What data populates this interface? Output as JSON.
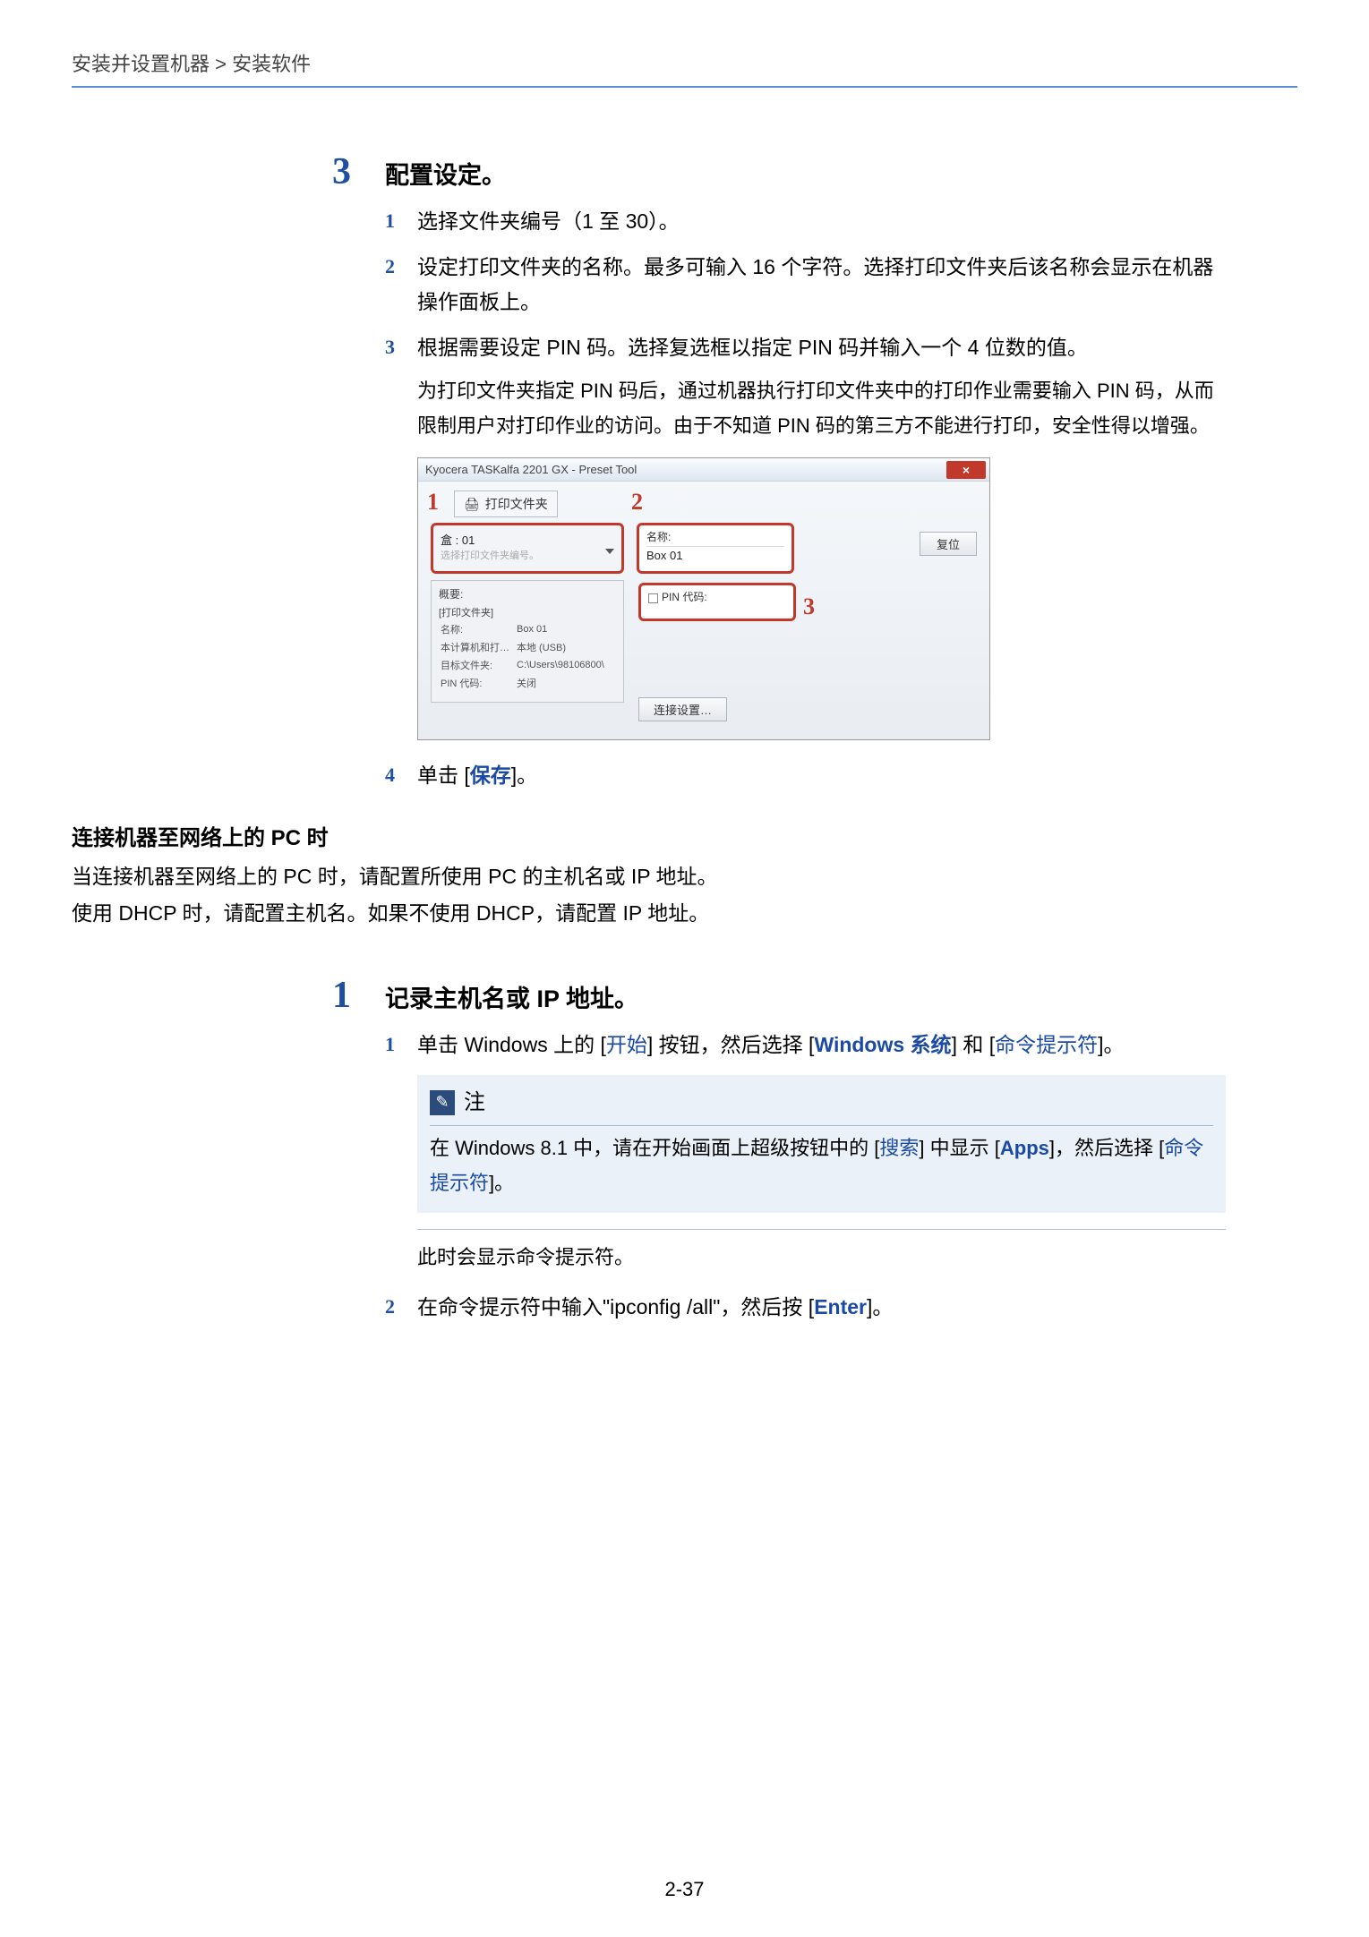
{
  "breadcrumb": "安装并设置机器 > 安装软件",
  "step3": {
    "num": "3",
    "title": "配置设定。",
    "s1": {
      "n": "1",
      "t": "选择文件夹编号（1 至 30）。"
    },
    "s2": {
      "n": "2",
      "t": "设定打印文件夹的名称。最多可输入 16 个字符。选择打印文件夹后该名称会显示在机器操作面板上。"
    },
    "s3": {
      "n": "3",
      "t": "根据需要设定 PIN 码。选择复选框以指定 PIN 码并输入一个 4 位数的值。"
    },
    "extra": "为打印文件夹指定 PIN 码后，通过机器执行打印文件夹中的打印作业需要输入 PIN 码，从而限制用户对打印作业的访问。由于不知道 PIN 码的第三方不能进行打印，安全性得以增强。",
    "s4": {
      "n": "4",
      "pre": "单击 [",
      "link": "保存",
      "post": "]。"
    }
  },
  "tool": {
    "title": "Kyocera TASKalfa 2201 GX - Preset Tool",
    "close": "×",
    "c1": "1",
    "c2": "2",
    "c3": "3",
    "printFolder": "打印文件夹",
    "boxLabel": "盒 : 01",
    "boxHint": "选择打印文件夹编号。",
    "nameLbl": "名称:",
    "nameVal": "Box 01",
    "resetBtn": "复位",
    "pinLbl": "PIN 代码:",
    "summaryHdr": "概要:",
    "sumTitle": "[打印文件夹]",
    "r1a": "名称:",
    "r1b": "Box 01",
    "r2a": "本计算机和打…",
    "r2b": "本地 (USB)",
    "r3a": "目标文件夹:",
    "r3b": "C:\\Users\\98106800\\",
    "r4a": "PIN 代码:",
    "r4b": "关闭",
    "connBtn": "连接设置…"
  },
  "netHeading": "连接机器至网络上的 PC 时",
  "netP1": "当连接机器至网络上的 PC 时，请配置所使用 PC 的主机名或 IP 地址。",
  "netP2": "使用 DHCP 时，请配置主机名。如果不使用 DHCP，请配置 IP 地址。",
  "step1": {
    "num": "1",
    "title": "记录主机名或 IP 地址。",
    "s1": {
      "n": "1",
      "a": "单击 Windows 上的 [",
      "l1": "开始",
      "b": "] 按钮，然后选择 [",
      "l2": "Windows 系统",
      "c": "] 和 [",
      "l3": "命令提示符",
      "d": "]。"
    },
    "noteLabel": "注",
    "noteBody": {
      "a": "在 Windows 8.1 中，请在开始画面上超级按钮中的 [",
      "l1": "搜索",
      "b": "] 中显示 [",
      "l2": "Apps",
      "c": "]，然后选择 [",
      "l3": "命令提示符",
      "d": "]。"
    },
    "after": "此时会显示命令提示符。",
    "s2": {
      "n": "2",
      "a": "在命令提示符中输入\"ipconfig /all\"，然后按 [",
      "l": "Enter",
      "b": "]。"
    }
  },
  "pageNum": "2-37"
}
